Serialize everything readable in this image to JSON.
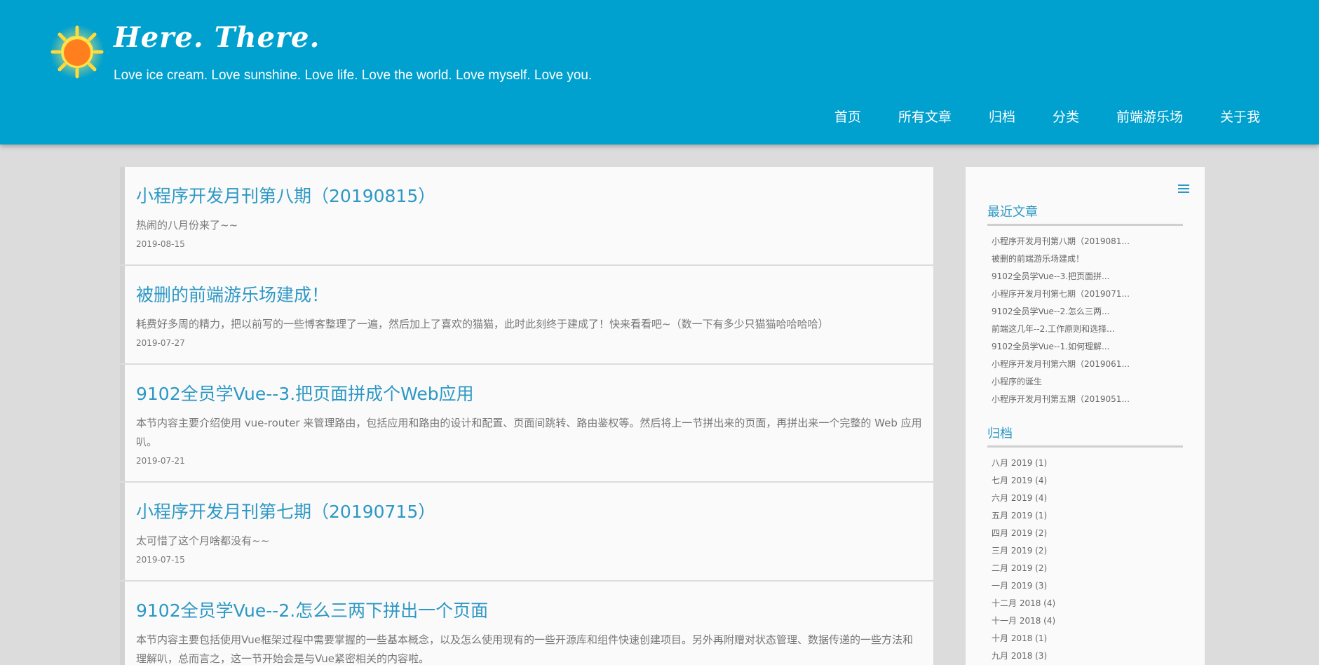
{
  "header": {
    "title": "Here. There.",
    "tagline": "Love ice cream. Love sunshine. Love life. Love the world. Love myself. Love you.",
    "logo_icon": "sun-icon",
    "bg_color": "#00a0cf"
  },
  "nav": [
    "首页",
    "所有文章",
    "归档",
    "分类",
    "前端游乐场",
    "关于我"
  ],
  "posts": [
    {
      "title": "小程序开发月刊第八期（20190815）",
      "summary": "热闹的八月份来了~~",
      "date": "2019-08-15"
    },
    {
      "title": "被删的前端游乐场建成！",
      "summary": "耗费好多周的精力，把以前写的一些博客整理了一遍，然后加上了喜欢的猫猫，此时此刻终于建成了！快来看看吧~（数一下有多少只猫猫哈哈哈哈）",
      "date": "2019-07-27"
    },
    {
      "title": "9102全员学Vue--3.把页面拼成个Web应用",
      "summary": "本节内容主要介绍使用 vue-router 来管理路由，包括应用和路由的设计和配置、页面间跳转、路由鉴权等。然后将上一节拼出来的页面，再拼出来一个完整的 Web 应用叭。",
      "date": "2019-07-21"
    },
    {
      "title": "小程序开发月刊第七期（20190715）",
      "summary": "太可惜了这个月啥都没有~~",
      "date": "2019-07-15"
    },
    {
      "title": "9102全员学Vue--2.怎么三两下拼出一个页面",
      "summary": "本节内容主要包括使用Vue框架过程中需要掌握的一些基本概念，以及怎么使用现有的一些开源库和组件快速创建项目。另外再附赠对状态管理、数据传递的一些方法和理解叭，总而言之，这一节开始会是与Vue紧密相关的内容啦。",
      "date": ""
    }
  ],
  "sidebar": {
    "menu_icon": "menu-icon",
    "recent_title": "最近文章",
    "recent": [
      "小程序开发月刊第八期（2019081...",
      "被删的前端游乐场建成！",
      "9102全员学Vue--3.把页面拼...",
      "小程序开发月刊第七期（2019071...",
      "9102全员学Vue--2.怎么三两...",
      "前端这几年--2.工作原则和选择...",
      "9102全员学Vue--1.如何理解...",
      "小程序开发月刊第六期（2019061...",
      "小程序的诞生",
      "小程序开发月刊第五期（2019051..."
    ],
    "archive_title": "归档",
    "archives": [
      "八月 2019 (1)",
      "七月 2019 (4)",
      "六月 2019 (4)",
      "五月 2019 (1)",
      "四月 2019 (2)",
      "三月 2019 (2)",
      "二月 2019 (2)",
      "一月 2019 (3)",
      "十二月 2018 (4)",
      "十一月 2018 (4)",
      "十月 2018 (1)",
      "九月 2018 (3)"
    ]
  },
  "colors": {
    "accent": "#2d98c4",
    "header": "#00a0cf",
    "background": "#dcdcdc"
  }
}
